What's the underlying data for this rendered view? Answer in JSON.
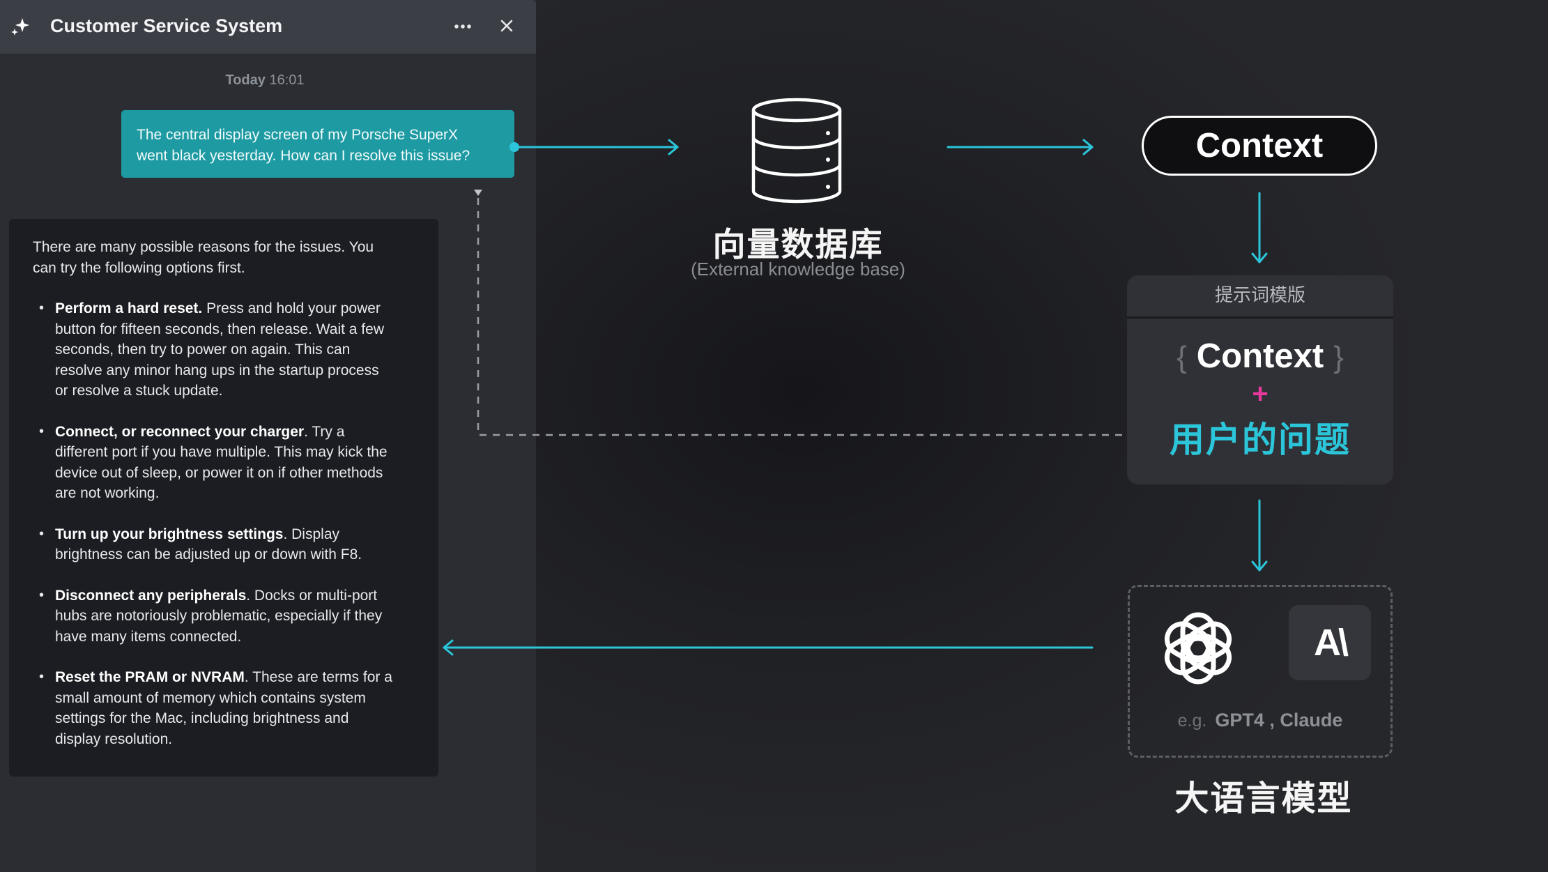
{
  "window": {
    "title": "Customer Service System",
    "sparkle_icon": "sparkle-icon",
    "more_icon": "more-horizontal-icon",
    "close_icon": "close-icon"
  },
  "chat": {
    "timestamp_day": "Today",
    "timestamp_time": "16:01",
    "user_message_line1": "The central display screen of my Porsche SuperX",
    "user_message_line2": "went black yesterday. How can I resolve this issue?",
    "bot_intro_line1": "There are many possible reasons for the issues. You",
    "bot_intro_line2": "can try the following options first.",
    "bot_items": [
      {
        "title": "Perform a hard reset.",
        "lines": [
          " Press and hold your power",
          "button for fifteen seconds, then release. Wait a few",
          "seconds, then try to power on again. This can",
          "resolve any minor hang ups in the startup process",
          "or resolve a stuck update."
        ]
      },
      {
        "title": "Connect, or reconnect your charger",
        "lines": [
          ". Try a",
          "different port if you have multiple. This may kick the",
          "device out of sleep, or power it on if other methods",
          "are not working."
        ]
      },
      {
        "title": "Turn up your brightness settings",
        "lines": [
          ".  Display",
          "brightness can be adjusted up or down with F8."
        ]
      },
      {
        "title": "Disconnect any peripherals",
        "lines": [
          ". Docks or multi-port",
          "hubs are notoriously problematic, especially if they",
          "have many items connected."
        ]
      },
      {
        "title": "Reset the PRAM or NVRAM",
        "lines": [
          ". These are terms for a",
          "small amount of memory which contains system",
          "settings for the Mac, including brightness and",
          "display resolution."
        ]
      }
    ]
  },
  "diagram": {
    "database_icon": "database-icon",
    "database_title": "向量数据库",
    "database_subtitle": "(External knowledge base)",
    "context_label": "Context",
    "template_header": "提示词模版",
    "template_context": "Context",
    "brace_open": "{",
    "brace_close": "}",
    "plus": "+",
    "user_question": "用户的问题",
    "openai_icon": "openai-logo-icon",
    "anthropic_icon": "anthropic-logo-icon",
    "anthropic_text": "A\\",
    "examples_prefix": "e.g.",
    "examples_models": "GPT4 , Claude",
    "llm_title": "大语言模型",
    "accent_color": "#2cc6da",
    "plus_color": "#e6399b"
  }
}
